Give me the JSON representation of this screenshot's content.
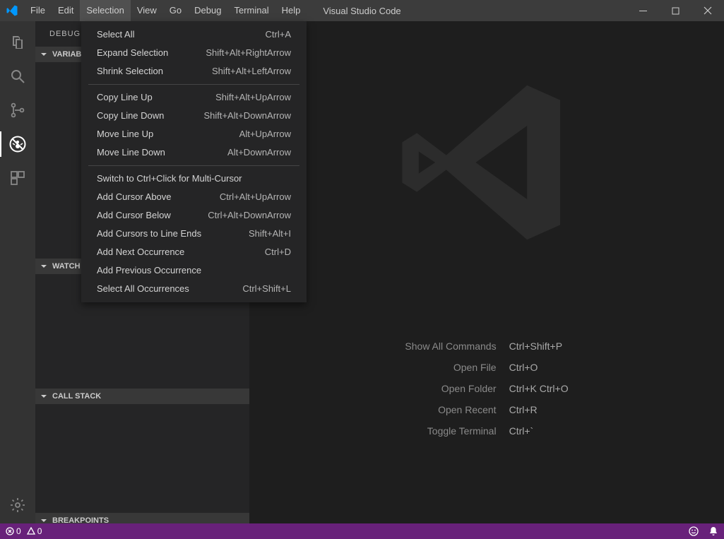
{
  "app_title": "Visual Studio Code",
  "menu": {
    "items": [
      "File",
      "Edit",
      "Selection",
      "View",
      "Go",
      "Debug",
      "Terminal",
      "Help"
    ],
    "active_index": 2
  },
  "dropdown": {
    "groups": [
      [
        {
          "label": "Select All",
          "shortcut": "Ctrl+A"
        },
        {
          "label": "Expand Selection",
          "shortcut": "Shift+Alt+RightArrow"
        },
        {
          "label": "Shrink Selection",
          "shortcut": "Shift+Alt+LeftArrow"
        }
      ],
      [
        {
          "label": "Copy Line Up",
          "shortcut": "Shift+Alt+UpArrow"
        },
        {
          "label": "Copy Line Down",
          "shortcut": "Shift+Alt+DownArrow"
        },
        {
          "label": "Move Line Up",
          "shortcut": "Alt+UpArrow"
        },
        {
          "label": "Move Line Down",
          "shortcut": "Alt+DownArrow"
        }
      ],
      [
        {
          "label": "Switch to Ctrl+Click for Multi-Cursor",
          "shortcut": ""
        },
        {
          "label": "Add Cursor Above",
          "shortcut": "Ctrl+Alt+UpArrow"
        },
        {
          "label": "Add Cursor Below",
          "shortcut": "Ctrl+Alt+DownArrow"
        },
        {
          "label": "Add Cursors to Line Ends",
          "shortcut": "Shift+Alt+I"
        },
        {
          "label": "Add Next Occurrence",
          "shortcut": "Ctrl+D"
        },
        {
          "label": "Add Previous Occurrence",
          "shortcut": ""
        },
        {
          "label": "Select All Occurrences",
          "shortcut": "Ctrl+Shift+L"
        }
      ]
    ]
  },
  "debug": {
    "title": "DEBUG",
    "sections": [
      "VARIABLES",
      "WATCH",
      "CALL STACK",
      "BREAKPOINTS"
    ]
  },
  "hints": [
    {
      "label": "Show All Commands",
      "keys": "Ctrl+Shift+P"
    },
    {
      "label": "Open File",
      "keys": "Ctrl+O"
    },
    {
      "label": "Open Folder",
      "keys": "Ctrl+K Ctrl+O"
    },
    {
      "label": "Open Recent",
      "keys": "Ctrl+R"
    },
    {
      "label": "Toggle Terminal",
      "keys": "Ctrl+`"
    }
  ],
  "status": {
    "errors": "0",
    "warnings": "0"
  }
}
